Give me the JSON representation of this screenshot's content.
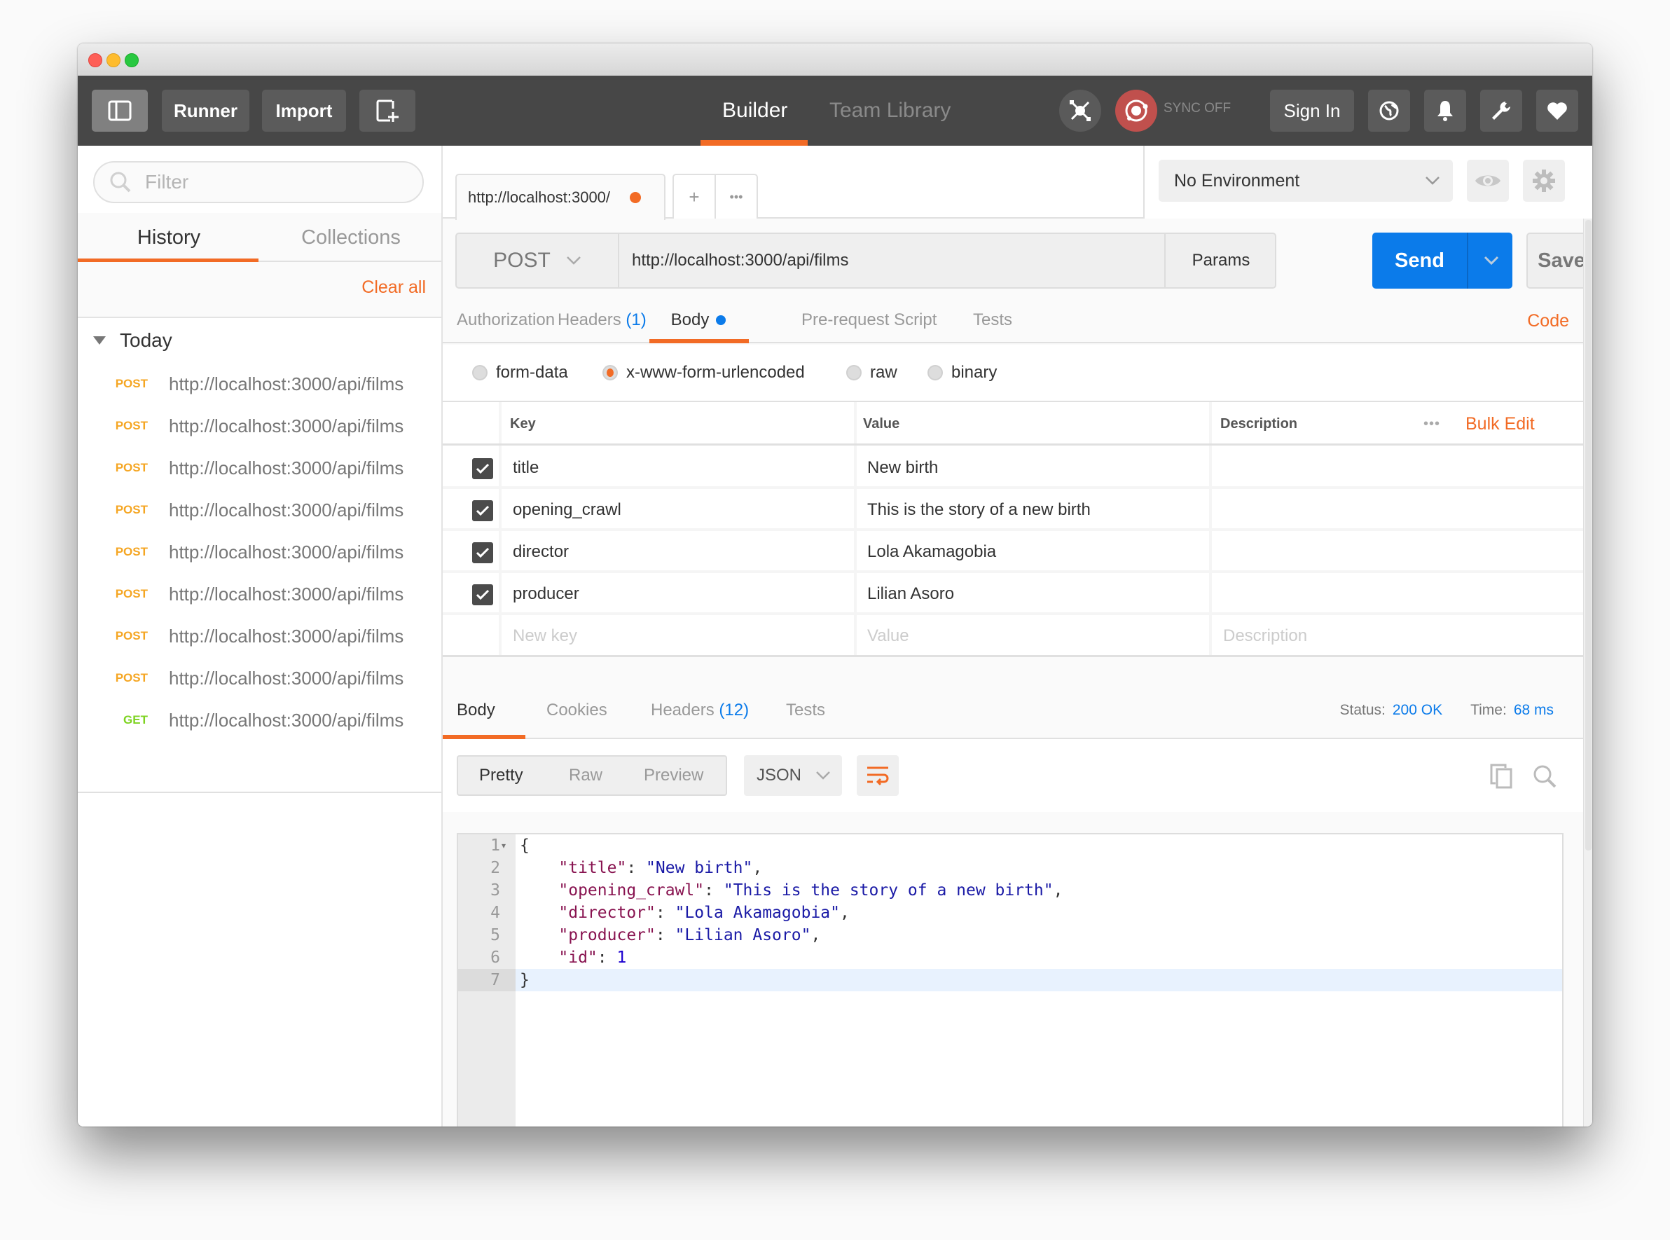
{
  "window": {
    "controls": [
      "close",
      "minimize",
      "zoom"
    ]
  },
  "header": {
    "sidebar_toggle_icon": "sidebar-toggle-icon",
    "runner_label": "Runner",
    "import_label": "Import",
    "new_window_icon": "new-window-icon",
    "tabs": [
      {
        "label": "Builder",
        "active": true
      },
      {
        "label": "Team Library",
        "active": false
      }
    ],
    "interceptor_icon": "satellite-icon",
    "sync_icon": "sync-icon",
    "sync_label": "SYNC OFF",
    "sign_in_label": "Sign In",
    "right_icons": [
      "globe-icon",
      "bell-icon",
      "wrench-icon",
      "heart-icon"
    ],
    "accent_color": "#f26b25",
    "sync_color": "#c0504d"
  },
  "sidebar": {
    "filter_placeholder": "Filter",
    "tabs": [
      {
        "label": "History",
        "active": true
      },
      {
        "label": "Collections",
        "active": false
      }
    ],
    "clear_all_label": "Clear all",
    "group_label": "Today",
    "history": [
      {
        "method": "POST",
        "url": "http://localhost:3000/api/films"
      },
      {
        "method": "POST",
        "url": "http://localhost:3000/api/films"
      },
      {
        "method": "POST",
        "url": "http://localhost:3000/api/films"
      },
      {
        "method": "POST",
        "url": "http://localhost:3000/api/films"
      },
      {
        "method": "POST",
        "url": "http://localhost:3000/api/films"
      },
      {
        "method": "POST",
        "url": "http://localhost:3000/api/films"
      },
      {
        "method": "POST",
        "url": "http://localhost:3000/api/films"
      },
      {
        "method": "POST",
        "url": "http://localhost:3000/api/films"
      },
      {
        "method": "GET",
        "url": "http://localhost:3000/api/films"
      }
    ],
    "method_colors": {
      "POST": "#f5a623",
      "GET": "#7ed321"
    }
  },
  "request": {
    "tab_label": "http://localhost:3000/",
    "tab_add": "+",
    "tab_more": "•••",
    "environment": "No Environment",
    "method": "POST",
    "url": "http://localhost:3000/api/films",
    "params_label": "Params",
    "send_label": "Send",
    "save_label": "Save",
    "tabs": [
      {
        "label": "Authorization",
        "count": null,
        "active": false
      },
      {
        "label": "Headers",
        "count": "(1)",
        "active": false
      },
      {
        "label": "Body",
        "count": null,
        "active": true
      },
      {
        "label": "Pre-request Script",
        "count": null,
        "active": false
      },
      {
        "label": "Tests",
        "count": null,
        "active": false
      }
    ],
    "code_label": "Code",
    "body_types": [
      {
        "label": "form-data",
        "selected": false
      },
      {
        "label": "x-www-form-urlencoded",
        "selected": true
      },
      {
        "label": "raw",
        "selected": false
      },
      {
        "label": "binary",
        "selected": false
      }
    ],
    "table": {
      "headers": {
        "key": "Key",
        "value": "Value",
        "description": "Description"
      },
      "more_label": "•••",
      "bulk_edit_label": "Bulk Edit",
      "rows": [
        {
          "checked": true,
          "key": "title",
          "value": "New birth",
          "description": ""
        },
        {
          "checked": true,
          "key": "opening_crawl",
          "value": "This is the story of a new birth",
          "description": ""
        },
        {
          "checked": true,
          "key": "director",
          "value": "Lola Akamagobia",
          "description": ""
        },
        {
          "checked": true,
          "key": "producer",
          "value": "Lilian Asoro",
          "description": ""
        }
      ],
      "new_row_placeholders": {
        "key": "New key",
        "value": "Value",
        "description": "Description"
      }
    }
  },
  "response": {
    "tabs": [
      {
        "label": "Body",
        "count": null,
        "active": true
      },
      {
        "label": "Cookies",
        "count": null,
        "active": false
      },
      {
        "label": "Headers",
        "count": "(12)",
        "active": false
      },
      {
        "label": "Tests",
        "count": null,
        "active": false
      }
    ],
    "status_label": "Status:",
    "status_value": "200 OK",
    "time_label": "Time:",
    "time_value": "68 ms",
    "view_modes": [
      {
        "label": "Pretty",
        "active": true
      },
      {
        "label": "Raw",
        "active": false
      },
      {
        "label": "Preview",
        "active": false
      }
    ],
    "format": "JSON",
    "code_lines": [
      {
        "n": "1",
        "parts": [
          {
            "t": "{",
            "c": "p"
          }
        ]
      },
      {
        "n": "2",
        "parts": [
          {
            "t": "    ",
            "c": "p"
          },
          {
            "t": "\"title\"",
            "c": "k"
          },
          {
            "t": ": ",
            "c": "p"
          },
          {
            "t": "\"New birth\"",
            "c": "s"
          },
          {
            "t": ",",
            "c": "p"
          }
        ]
      },
      {
        "n": "3",
        "parts": [
          {
            "t": "    ",
            "c": "p"
          },
          {
            "t": "\"opening_crawl\"",
            "c": "k"
          },
          {
            "t": ": ",
            "c": "p"
          },
          {
            "t": "\"This is the story of a new birth\"",
            "c": "s"
          },
          {
            "t": ",",
            "c": "p"
          }
        ]
      },
      {
        "n": "4",
        "parts": [
          {
            "t": "    ",
            "c": "p"
          },
          {
            "t": "\"director\"",
            "c": "k"
          },
          {
            "t": ": ",
            "c": "p"
          },
          {
            "t": "\"Lola Akamagobia\"",
            "c": "s"
          },
          {
            "t": ",",
            "c": "p"
          }
        ]
      },
      {
        "n": "5",
        "parts": [
          {
            "t": "    ",
            "c": "p"
          },
          {
            "t": "\"producer\"",
            "c": "k"
          },
          {
            "t": ": ",
            "c": "p"
          },
          {
            "t": "\"Lilian Asoro\"",
            "c": "s"
          },
          {
            "t": ",",
            "c": "p"
          }
        ]
      },
      {
        "n": "6",
        "parts": [
          {
            "t": "    ",
            "c": "p"
          },
          {
            "t": "\"id\"",
            "c": "k"
          },
          {
            "t": ": ",
            "c": "p"
          },
          {
            "t": "1",
            "c": "n"
          }
        ]
      },
      {
        "n": "7",
        "parts": [
          {
            "t": "}",
            "c": "p"
          }
        ]
      }
    ]
  }
}
